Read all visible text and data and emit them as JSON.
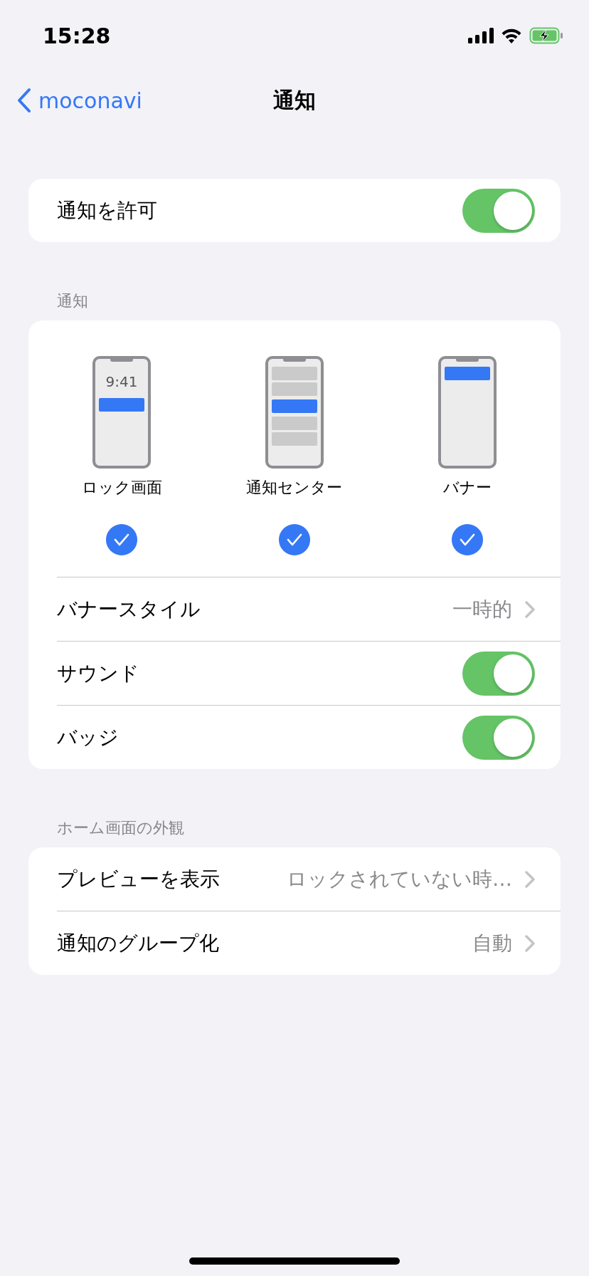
{
  "status_bar": {
    "time": "15:28"
  },
  "nav": {
    "back": "moconavi",
    "title": "通知"
  },
  "allow": {
    "label": "通知を許可",
    "on": true
  },
  "notifications": {
    "header": "通知",
    "styles": [
      {
        "kind": "lock",
        "label": "ロック画面",
        "clock": "9:41",
        "checked": true
      },
      {
        "kind": "center",
        "label": "通知センター",
        "checked": true
      },
      {
        "kind": "banner",
        "label": "バナー",
        "checked": true
      }
    ],
    "rows": [
      {
        "kind": "value",
        "label": "バナースタイル",
        "value": "一時的"
      },
      {
        "kind": "toggle",
        "label": "サウンド",
        "on": true
      },
      {
        "kind": "toggle",
        "label": "バッジ",
        "on": true
      }
    ]
  },
  "appearance": {
    "header": "ホーム画面の外観",
    "rows": [
      {
        "label": "プレビューを表示",
        "value": "ロックされていない時…"
      },
      {
        "label": "通知のグループ化",
        "value": "自動"
      }
    ]
  }
}
